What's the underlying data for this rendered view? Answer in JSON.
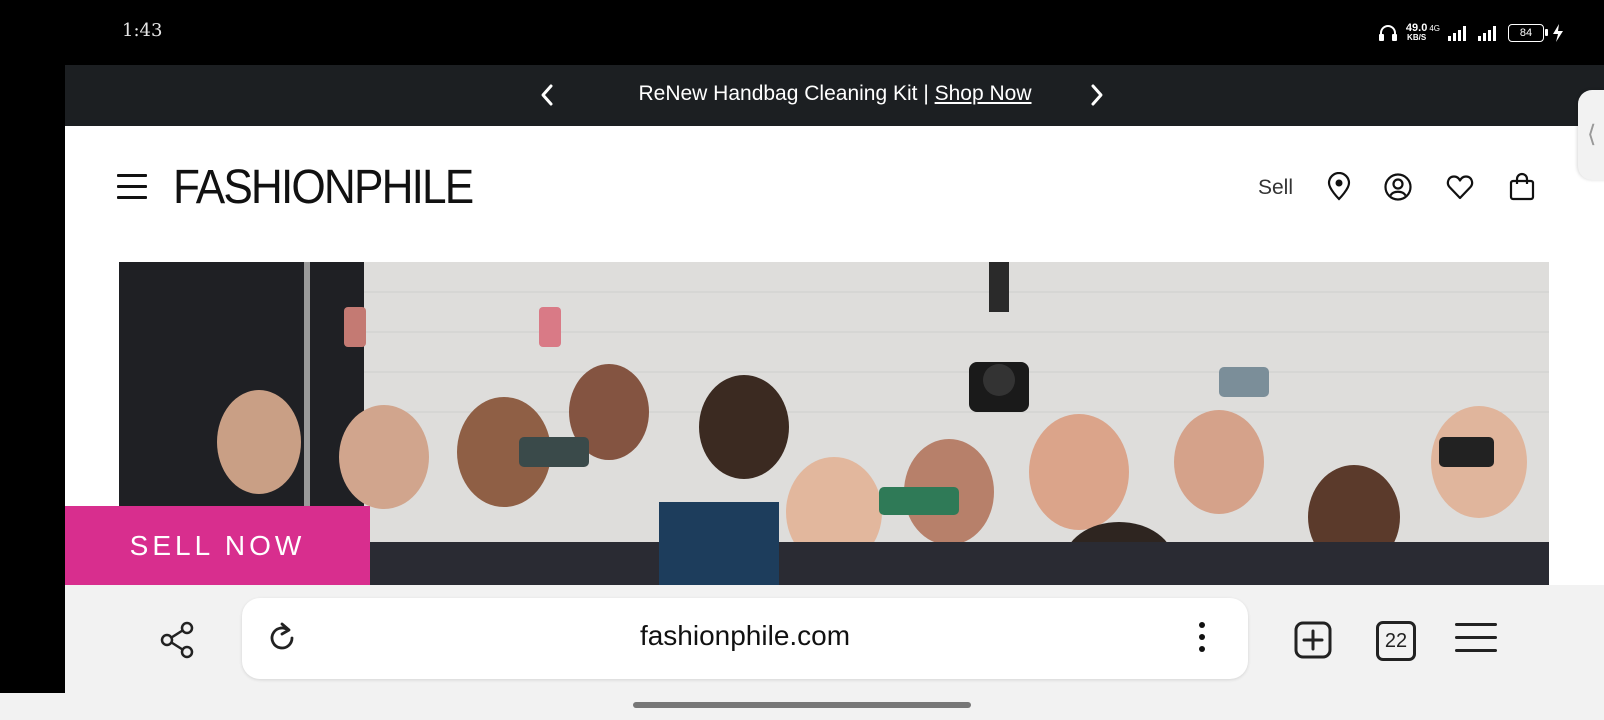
{
  "status": {
    "time": "1:43",
    "net_speed": "49.0",
    "net_unit": "KB/S",
    "network": "4G",
    "battery": "84"
  },
  "promo": {
    "text": "ReNew Handbag Cleaning Kit | ",
    "link": "Shop Now"
  },
  "header": {
    "logo": "FASHIONPHILE",
    "sell_label": "Sell"
  },
  "hero": {
    "cta_label": "SELL NOW"
  },
  "browser": {
    "url": "fashionphile.com",
    "tab_count": "22"
  },
  "colors": {
    "promo_bg": "#1c1f22",
    "cta_bg": "#d82e8e",
    "browser_bg": "#f2f2f2"
  }
}
